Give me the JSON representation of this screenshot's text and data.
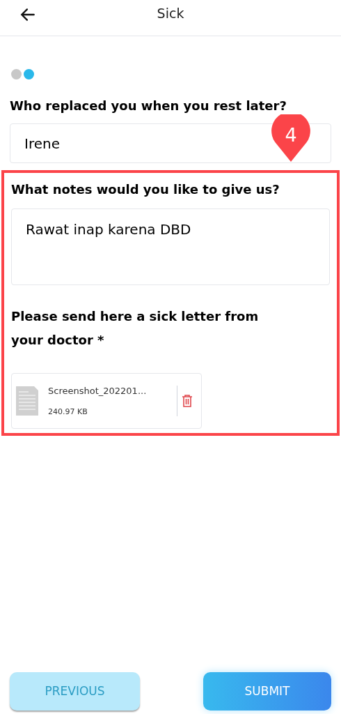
{
  "header": {
    "title": "Sick"
  },
  "steps": [
    {
      "selected": false
    },
    {
      "selected": true
    }
  ],
  "replacement": {
    "label": "Who replaced you when you rest later?",
    "value": "Irene"
  },
  "callout": {
    "number": "4"
  },
  "notes": {
    "label": "What notes would you like to give us?",
    "value": "Rawat inap karena DBD"
  },
  "letter": {
    "label": "Please send here a sick letter from your doctor *",
    "file": {
      "name": "Screenshot_202201...",
      "size": "240.97 KB"
    }
  },
  "buttons": [
    {
      "label": "PREVIOUS",
      "kind": "secondary"
    },
    {
      "label": "SUBMIT",
      "kind": "primary"
    }
  ]
}
